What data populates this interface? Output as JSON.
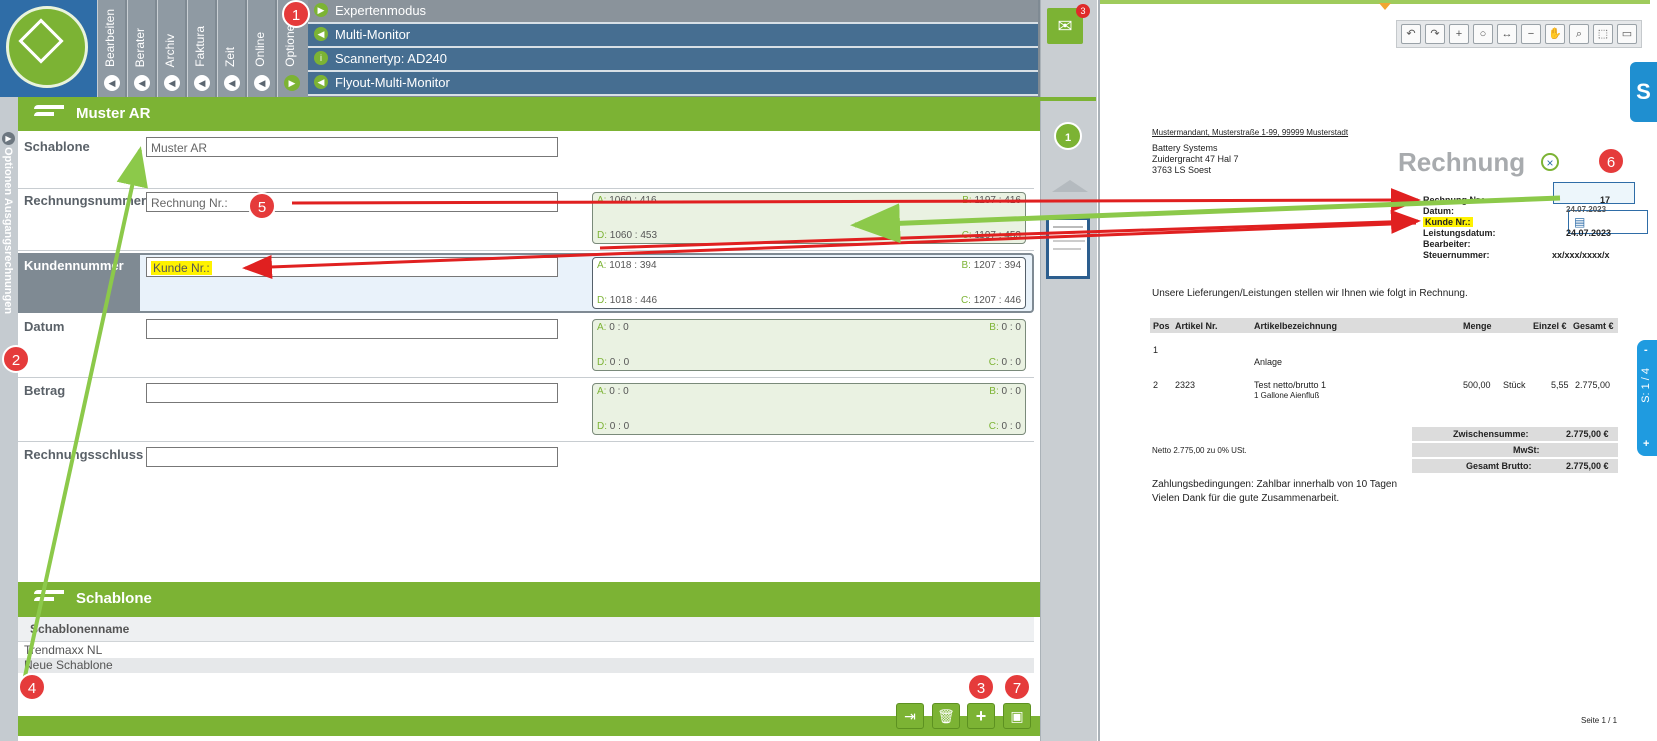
{
  "top_tabs": [
    {
      "label": "Bearbeiten"
    },
    {
      "label": "Berater"
    },
    {
      "label": "Archiv"
    },
    {
      "label": "Faktura"
    },
    {
      "label": "Zeit"
    },
    {
      "label": "Online"
    },
    {
      "label": "Optionen"
    }
  ],
  "menu": [
    {
      "label": "Expertenmodus"
    },
    {
      "label": "Multi-Monitor"
    },
    {
      "label": "Scannertyp: AD240"
    },
    {
      "label": "Flyout-Multi-Monitor"
    }
  ],
  "left_strip": {
    "label": "Optionen   Ausgangsrechnungen"
  },
  "section_main": {
    "title": "Muster AR"
  },
  "fields": [
    {
      "label": "Schablone",
      "value": "Muster AR"
    },
    {
      "label": "Rechnungsnummer",
      "value": "Rechnung Nr.:",
      "zone": {
        "A": "1060 : 416",
        "B": "1197 : 416",
        "C": "1197 : 453",
        "D": "1060 : 453"
      }
    },
    {
      "label": "Kundennummer",
      "value": "Kunde Nr.:",
      "zone": {
        "A": "1018 : 394",
        "B": "1207 : 394",
        "C": "1207 : 446",
        "D": "1018 : 446"
      }
    },
    {
      "label": "Datum",
      "value": "",
      "zone": {
        "A": "0 : 0",
        "B": "0 : 0",
        "C": "0 : 0",
        "D": "0 : 0"
      }
    },
    {
      "label": "Betrag",
      "value": "",
      "zone": {
        "A": "0 : 0",
        "B": "0 : 0",
        "C": "0 : 0",
        "D": "0 : 0"
      }
    },
    {
      "label": "Rechnungsschluss",
      "value": ""
    }
  ],
  "zone_keys": {
    "a": "A:",
    "b": "B:",
    "c": "C:",
    "d": "D:"
  },
  "section_templates": {
    "title": "Schablone",
    "column": "Schablonenname",
    "rows": [
      "Trendmaxx NL",
      "Neue Schablone"
    ]
  },
  "mid": {
    "mail_count": "3",
    "page_number": "1"
  },
  "doc": {
    "sender_line": "Mustermandant, Musterstraße 1-99, 99999 Musterstadt",
    "recipient": [
      "Battery Systems",
      "Zuidergracht 47 Hal 7",
      "3763 LS Soest"
    ],
    "title": "Rechnung",
    "meta": [
      {
        "label": "Rechnung Nr.:",
        "value": "17"
      },
      {
        "label": "Datum:",
        "value": "24.07.2023"
      },
      {
        "label": "Kunde Nr.:",
        "value": ""
      },
      {
        "label": "Leistungsdatum:",
        "value": "24.07.2023"
      },
      {
        "label": "Bearbeiter:",
        "value": ""
      },
      {
        "label": "Steuernummer:",
        "value": "xx/xxx/xxxx/x"
      }
    ],
    "intro": "Unsere Lieferungen/Leistungen stellen wir Ihnen wie folgt in Rechnung.",
    "table_head": [
      "Pos",
      "Artikel Nr.",
      "Artikelbezeichnung",
      "Menge",
      "Einzel €",
      "Gesamt €"
    ],
    "row1": {
      "pos": "1",
      "desc2": "Anlage"
    },
    "row2": {
      "pos": "2",
      "art": "2323",
      "desc": "Test netto/brutto 1",
      "desc2": "1 Gallone Aienfluß",
      "qty": "500,00",
      "unit": "Stück",
      "price": "5,55",
      "total": "2.775,00"
    },
    "tax_note": "Netto 2.775,00 zu 0% USt.",
    "sum_label": "Zwischensumme:",
    "sum_value": "2.775,00 €",
    "vat_label": "MwSt:",
    "gross_label": "Gesamt Brutto:",
    "gross_value": "2.775,00 €",
    "terms": "Zahlungsbedingungen: Zahlbar innerhalb von 10 Tagen",
    "thanks": "Vielen Dank für die gute Zusammenarbeit.",
    "page": "Seite 1 / 1",
    "side_page": "S: 1 / 4",
    "side_logo": "S"
  },
  "badges": [
    "1",
    "2",
    "3",
    "4",
    "5",
    "6",
    "7"
  ],
  "colors": {
    "green": "#7cb334",
    "blue": "#466e91",
    "red_arrow": "#e02020",
    "green_arrow": "#8cc94a"
  }
}
